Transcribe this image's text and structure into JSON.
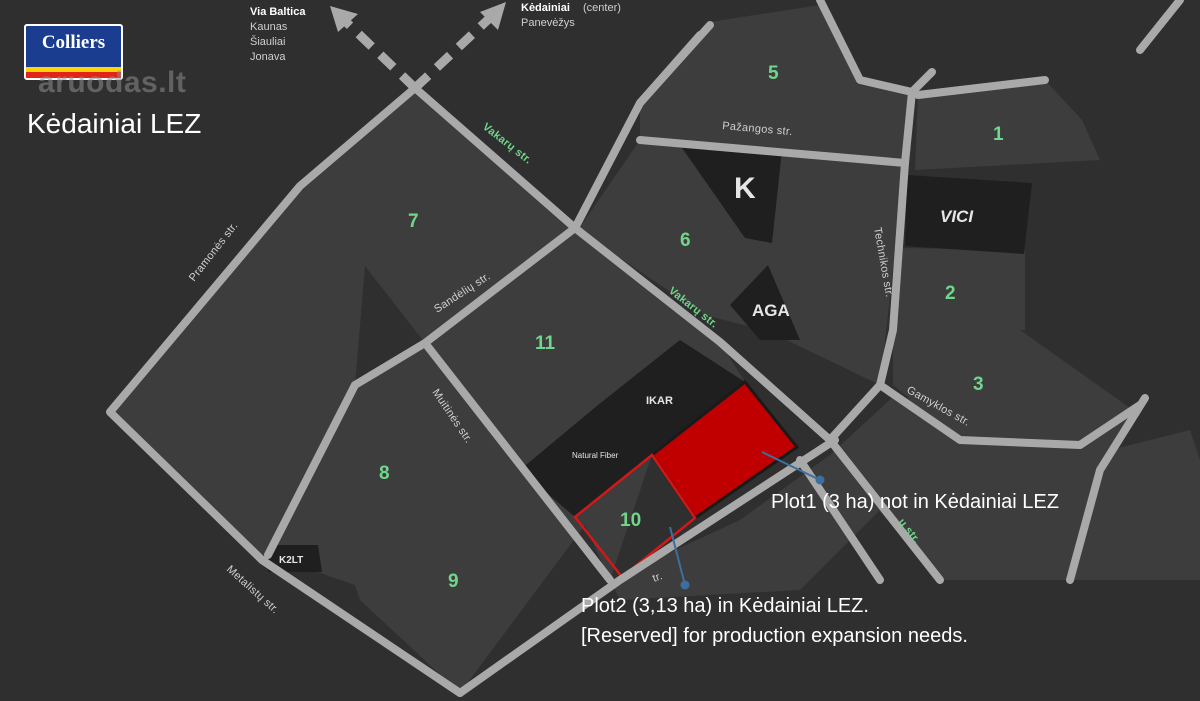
{
  "brand": {
    "logo_text": "Colliers",
    "watermark": "aruodas.lt"
  },
  "title": "Kėdainiai LEZ",
  "directions": [
    {
      "title": "Via Baltica",
      "lines": [
        "Kaunas",
        "Šiauliai",
        "Jonava"
      ]
    },
    {
      "title": "Kėdainiai",
      "title_suffix": "(center)",
      "lines": [
        "Panevėžys"
      ]
    }
  ],
  "streets": {
    "vakaru_1": "Vakarų str.",
    "vakaru_2": "Vakarų str.",
    "pramones": "Pramonės str.",
    "sandeliu": "Sandėlių str.",
    "pazangos": "Pažangos str.",
    "technikos": "Technikos str.",
    "gamyklos": "Gamyklos str.",
    "muitines": "Muitinės str.",
    "metalistu": "Metalistų str.",
    "partial_right": "ų str.",
    "partial_bottom": "tr."
  },
  "plots": [
    "1",
    "2",
    "3",
    "5",
    "6",
    "7",
    "8",
    "9",
    "10",
    "11"
  ],
  "company_logos": {
    "k": "K",
    "vici": "VICI",
    "aga": "AGA",
    "ikar": "IKAR",
    "natural_fiber": "Natural Fiber",
    "k2lt": "K2LT"
  },
  "callouts": {
    "plot1": "Plot1 (3 ha) not in Kėdainiai LEZ",
    "plot2_line1": "Plot2 (3,13 ha) in Kėdainiai LEZ.",
    "plot2_line2": "[Reserved] for production expansion needs."
  },
  "colors": {
    "background": "#2f2f2f",
    "block": "#3d3d3d",
    "road": "#a9a9a9",
    "plot_number": "#6fd68a",
    "highlight_plot": "#c00000",
    "company_block": "#1f1f1f",
    "leader_line": "#3d6f9e"
  }
}
